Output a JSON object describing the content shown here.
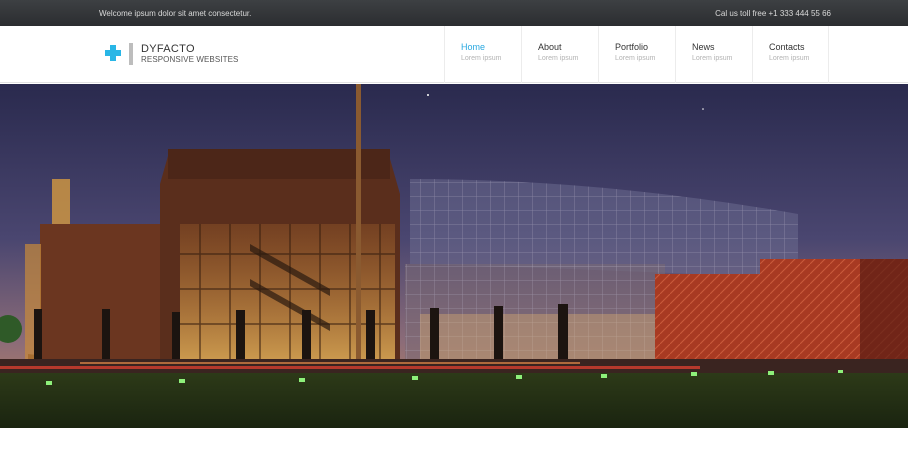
{
  "topbar": {
    "welcome": "Welcome ipsum dolor sit amet consectetur.",
    "phone": "Cal us toll free +1 333 444 55 66"
  },
  "logo": {
    "name": "DYFACTO",
    "tagline": "RESPONSIVE WEBSITES",
    "accent_color": "#29b6e6"
  },
  "nav": {
    "active_color": "#29a8e0",
    "items": [
      {
        "label": "Home",
        "sub": "Lorem ipsum"
      },
      {
        "label": "About",
        "sub": "Lorem ipsum"
      },
      {
        "label": "Portfolio",
        "sub": "Lorem ipsum"
      },
      {
        "label": "News",
        "sub": "Lorem ipsum"
      },
      {
        "label": "Contacts",
        "sub": "Lorem ipsum"
      }
    ]
  }
}
